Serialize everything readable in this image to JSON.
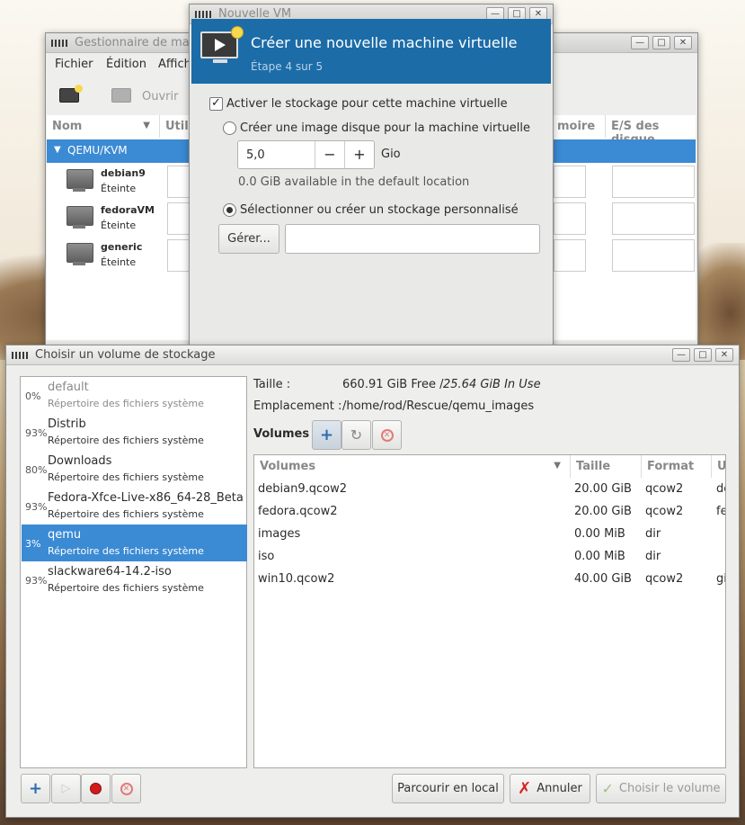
{
  "manager": {
    "title": "Gestionnaire de ma",
    "menu": [
      "Fichier",
      "Édition",
      "Affich"
    ],
    "toolbar_open": "Ouvrir",
    "columns": [
      "Nom",
      "Util",
      "moire",
      "E/S des disque"
    ],
    "group": "QEMU/KVM",
    "vms": [
      {
        "name": "debian9",
        "state": "Éteinte"
      },
      {
        "name": "fedoraVM",
        "state": "Éteinte"
      },
      {
        "name": "generic",
        "state": "Éteinte"
      }
    ]
  },
  "newvm": {
    "title": "Nouvelle VM",
    "header_title": "Créer une nouvelle machine virtuelle",
    "header_step": "Étape 4 sur 5",
    "enable_storage": "Activer le stockage pour cette machine virtuelle",
    "create_image": "Créer une image disque pour la machine virtuelle",
    "size_value": "5,0",
    "size_unit": "Gio",
    "available": "0.0 GiB available in the default location",
    "custom_storage": "Sélectionner ou créer un stockage personnalisé",
    "manage_label": "Gérer..."
  },
  "chooser": {
    "title": "Choisir un volume de stockage",
    "pools": [
      {
        "pct": "0%",
        "name": "default",
        "type": "Répertoire des fichiers système"
      },
      {
        "pct": "93%",
        "name": "Distrib",
        "type": "Répertoire des fichiers système"
      },
      {
        "pct": "80%",
        "name": "Downloads",
        "type": "Répertoire des fichiers système"
      },
      {
        "pct": "93%",
        "name": "Fedora-Xfce-Live-x86_64-28_Beta",
        "type": "Répertoire des fichiers système"
      },
      {
        "pct": "3%",
        "name": "qemu",
        "type": "Répertoire des fichiers système"
      },
      {
        "pct": "93%",
        "name": "slackware64-14.2-iso",
        "type": "Répertoire des fichiers système"
      }
    ],
    "size_label": "Taille :",
    "size_free": "660.91 GiB Free /",
    "size_inuse": "25.64 GiB In Use",
    "location_label": "Emplacement :",
    "location_value": "/home/rod/Rescue/qemu_images",
    "volumes_label": "Volumes",
    "columns": [
      "Volumes",
      "Taille",
      "Format",
      "U"
    ],
    "volumes": [
      {
        "name": "debian9.qcow2",
        "size": "20.00 GiB",
        "format": "qcow2",
        "used": "de"
      },
      {
        "name": "fedora.qcow2",
        "size": "20.00 GiB",
        "format": "qcow2",
        "used": "fe"
      },
      {
        "name": "images",
        "size": "0.00 MiB",
        "format": "dir",
        "used": ""
      },
      {
        "name": "iso",
        "size": "0.00 MiB",
        "format": "dir",
        "used": ""
      },
      {
        "name": "win10.qcow2",
        "size": "40.00 GiB",
        "format": "qcow2",
        "used": "gi"
      }
    ],
    "browse_local": "Parcourir en local",
    "cancel": "Annuler",
    "choose": "Choisir le volume"
  }
}
